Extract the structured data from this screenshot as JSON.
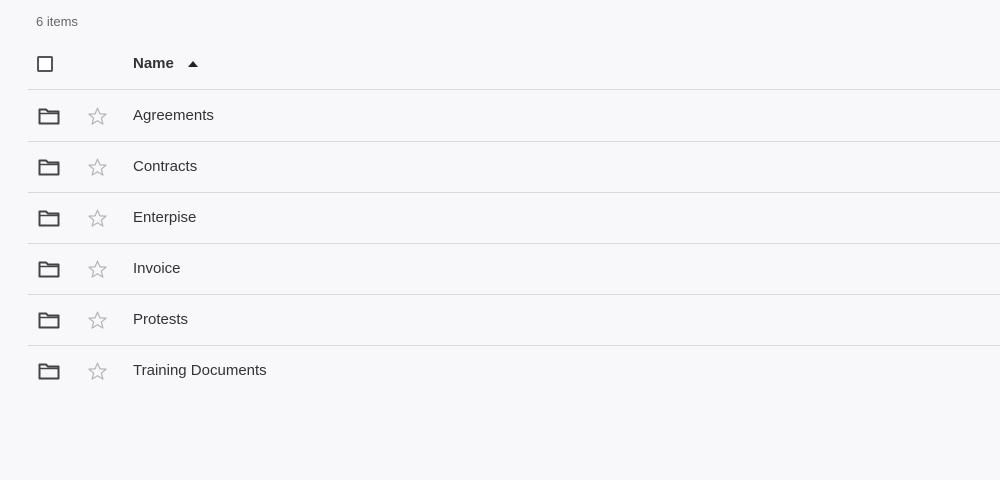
{
  "list": {
    "count_label": "6 items",
    "header": {
      "name_label": "Name",
      "sort": "ascending"
    },
    "items": [
      {
        "label": "Agreements",
        "icon": "folder-icon",
        "starred": false
      },
      {
        "label": "Contracts",
        "icon": "folder-icon",
        "starred": false
      },
      {
        "label": "Enterpise",
        "icon": "folder-icon",
        "starred": false
      },
      {
        "label": "Invoice",
        "icon": "folder-icon",
        "starred": false
      },
      {
        "label": "Protests",
        "icon": "folder-icon",
        "starred": false
      },
      {
        "label": "Training Documents",
        "icon": "folder-icon",
        "starred": false
      }
    ]
  },
  "colors": {
    "background": "#f8f8fa",
    "divider": "#d9d9dc",
    "text": "#333333",
    "star_outline": "#b5b5b8",
    "icon": "#444444"
  }
}
